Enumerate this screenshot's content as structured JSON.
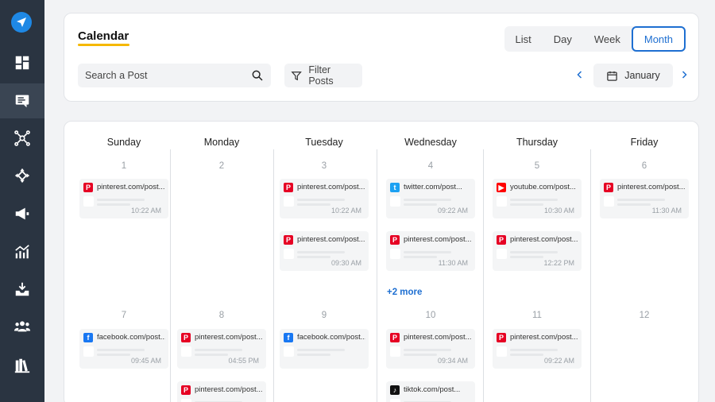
{
  "header": {
    "title": "Calendar",
    "views": [
      "List",
      "Day",
      "Week",
      "Month"
    ],
    "active_view": "Month",
    "search_placeholder": "Search a Post",
    "filter_label": "Filter Posts",
    "month": "January"
  },
  "colors": {
    "sidebar": "#2a3441",
    "accent": "#1e6fd1",
    "title_underline": "#f5b800",
    "pinterest": "#e60023",
    "twitter": "#1da1f2",
    "youtube": "#ff0000",
    "facebook": "#1877f2",
    "tiktok": "#111111"
  },
  "sidebar_icons": [
    "logo-send-icon",
    "dashboard-icon",
    "posts-icon",
    "network-icon",
    "move-icon",
    "megaphone-icon",
    "analytics-icon",
    "download-icon",
    "users-icon",
    "library-icon"
  ],
  "days": [
    "Sunday",
    "Monday",
    "Tuesday",
    "Wednesday",
    "Thursday",
    "Friday"
  ],
  "weeks": [
    {
      "dates": [
        "1",
        "2",
        "3",
        "4",
        "5",
        "6"
      ],
      "cells": [
        [
          {
            "network": "pinterest",
            "url": "pinterest.com/post...",
            "time": "10:22 AM"
          }
        ],
        [],
        [
          {
            "network": "pinterest",
            "url": "pinterest.com/post...",
            "time": "10:22 AM"
          },
          {
            "network": "pinterest",
            "url": "pinterest.com/post...",
            "time": "09:30 AM"
          }
        ],
        [
          {
            "network": "twitter",
            "url": "twitter.com/post...",
            "time": "09:22 AM"
          },
          {
            "network": "pinterest",
            "url": "pinterest.com/post...",
            "time": "11:30 AM"
          }
        ],
        [
          {
            "network": "youtube",
            "url": "youtube.com/post...",
            "time": "10:30 AM"
          },
          {
            "network": "pinterest",
            "url": "pinterest.com/post...",
            "time": "12:22 PM"
          }
        ],
        [
          {
            "network": "pinterest",
            "url": "pinterest.com/post...",
            "time": "11:30 AM"
          }
        ]
      ],
      "more": {
        "col": 3,
        "label": "+2 more"
      }
    },
    {
      "dates": [
        "7",
        "8",
        "9",
        "10",
        "11",
        "12"
      ],
      "cells": [
        [
          {
            "network": "facebook",
            "url": "facebook.com/post...",
            "time": "09:45 AM"
          }
        ],
        [
          {
            "network": "pinterest",
            "url": "pinterest.com/post...",
            "time": "04:55 PM"
          },
          {
            "network": "pinterest",
            "url": "pinterest.com/post...",
            "time": ""
          }
        ],
        [
          {
            "network": "facebook",
            "url": "facebook.com/post...",
            "time": ""
          }
        ],
        [
          {
            "network": "pinterest",
            "url": "pinterest.com/post...",
            "time": "09:34 AM"
          },
          {
            "network": "tiktok",
            "url": "tiktok.com/post...",
            "time": ""
          }
        ],
        [
          {
            "network": "pinterest",
            "url": "pinterest.com/post...",
            "time": "09:22 AM"
          }
        ],
        []
      ]
    }
  ]
}
